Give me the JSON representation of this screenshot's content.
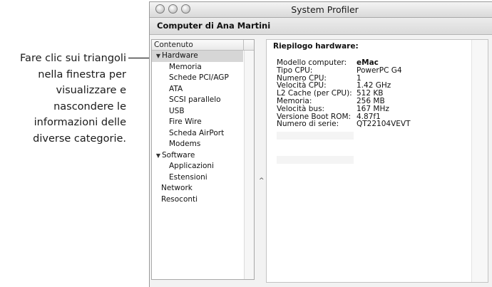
{
  "callout": {
    "lines": [
      "Fare clic sui triangoli",
      "nella finestra per",
      "visualizzare e",
      "nascondere le",
      "informazioni delle",
      "diverse categorie."
    ]
  },
  "window": {
    "title": "System Profiler",
    "computer_name": "Computer di Ana Martini"
  },
  "sidebar": {
    "header": "Contenuto",
    "items": [
      {
        "label": "Hardware",
        "level": 0,
        "expanded": true,
        "selected": true
      },
      {
        "label": "Memoria",
        "level": 1
      },
      {
        "label": "Schede PCI/AGP",
        "level": 1
      },
      {
        "label": "ATA",
        "level": 1
      },
      {
        "label": "SCSI parallelo",
        "level": 1
      },
      {
        "label": "USB",
        "level": 1
      },
      {
        "label": "Fire Wire",
        "level": 1
      },
      {
        "label": "Scheda AirPort",
        "level": 1
      },
      {
        "label": "Modems",
        "level": 1
      },
      {
        "label": "Software",
        "level": 0,
        "expanded": true
      },
      {
        "label": "Applicazioni",
        "level": 1
      },
      {
        "label": "Estensioni",
        "level": 1
      },
      {
        "label": "Network",
        "level": 0
      },
      {
        "label": "Resoconti",
        "level": 0
      }
    ]
  },
  "detail": {
    "title": "Riepilogo hardware:",
    "rows": [
      {
        "key": "Modello computer:",
        "value": "eMac"
      },
      {
        "key": "Tipo CPU:",
        "value": "PowerPC G4"
      },
      {
        "key": "Numero CPU:",
        "value": "1"
      },
      {
        "key": "Velocità CPU:",
        "value": "1.42 GHz"
      },
      {
        "key": "L2 Cache (per CPU):",
        "value": "512 KB"
      },
      {
        "key": "Memoria:",
        "value": "256 MB"
      },
      {
        "key": "Velocità bus:",
        "value": "167 MHz"
      },
      {
        "key": "Versione Boot ROM:",
        "value": "4.87f1"
      },
      {
        "key": "Numero di serie:",
        "value": "QT22104VEVT"
      }
    ]
  },
  "icons": {
    "expanded_triangle": "triangle-down-icon",
    "splitter": "splitter-handle-icon"
  }
}
